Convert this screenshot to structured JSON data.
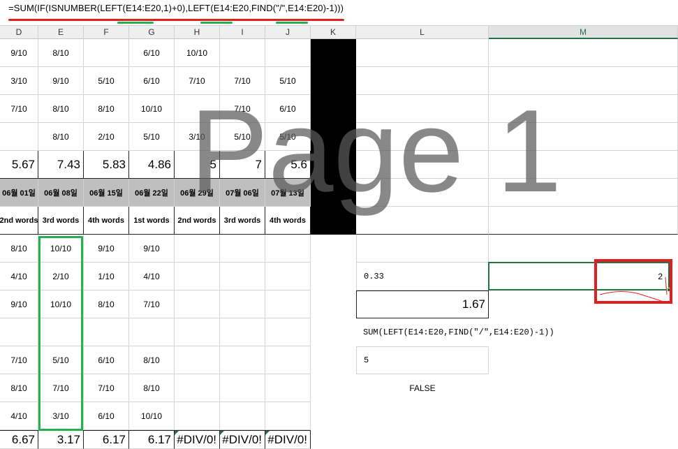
{
  "formula_bar": {
    "text": "=SUM(IF(ISNUMBER(LEFT(E14:E20,1)+0),LEFT(E14:E20,FIND(\"/\",E14:E20)-1)))"
  },
  "columns": [
    "D",
    "E",
    "F",
    "G",
    "H",
    "I",
    "J",
    "K",
    "L",
    "M"
  ],
  "grid": {
    "rows_top": [
      [
        "9/10",
        "8/10",
        "",
        "6/10",
        "10/10",
        "",
        ""
      ],
      [
        "3/10",
        "9/10",
        "5/10",
        "6/10",
        "7/10",
        "7/10",
        "5/10"
      ],
      [
        "7/10",
        "8/10",
        "8/10",
        "10/10",
        "",
        "7/10",
        "6/10"
      ],
      [
        "",
        "8/10",
        "2/10",
        "5/10",
        "3/10",
        "5/10",
        "5/10"
      ]
    ],
    "averages_top": [
      "5.67",
      "7.43",
      "5.83",
      "4.86",
      "5",
      "7",
      "5.6"
    ],
    "dates": [
      "06월 01일",
      "06월 08일",
      "06월 15일",
      "06월 22일",
      "06월 29일",
      "07월 06일",
      "07월 13일"
    ],
    "words": [
      "2nd words",
      "3rd words",
      "4th words",
      "1st words",
      "2nd words",
      "3rd words",
      "4th words"
    ],
    "rows_bottom": [
      [
        "8/10",
        "10/10",
        "9/10",
        "9/10",
        "",
        "",
        ""
      ],
      [
        "4/10",
        "2/10",
        "1/10",
        "4/10",
        "",
        "",
        ""
      ],
      [
        "9/10",
        "10/10",
        "8/10",
        "7/10",
        "",
        "",
        ""
      ],
      [
        "",
        "",
        "",
        "",
        "",
        "",
        ""
      ],
      [
        "7/10",
        "5/10",
        "6/10",
        "8/10",
        "",
        "",
        ""
      ],
      [
        "8/10",
        "7/10",
        "7/10",
        "8/10",
        "",
        "",
        ""
      ],
      [
        "4/10",
        "3/10",
        "6/10",
        "10/10",
        "",
        "",
        ""
      ]
    ],
    "averages_bottom": [
      "6.67",
      "3.17",
      "6.17",
      "6.17",
      "#DIV/0!",
      "#DIV/0!",
      "#DIV/0!"
    ]
  },
  "right_panel": {
    "l_value_1": "0.33",
    "m_value_1": "2",
    "l_value_2": "1.67",
    "formula_text": "SUM(LEFT(E14:E20,FIND(\"/\",E14:E20)-1))",
    "l_value_3": "5",
    "l_value_4": "FALSE"
  },
  "watermark": "Page 1",
  "colors": {
    "red_annotation": "#e02020",
    "green_annotation": "#22b14c",
    "excel_green": "#217346",
    "date_row_bg": "#bfbfbf"
  }
}
